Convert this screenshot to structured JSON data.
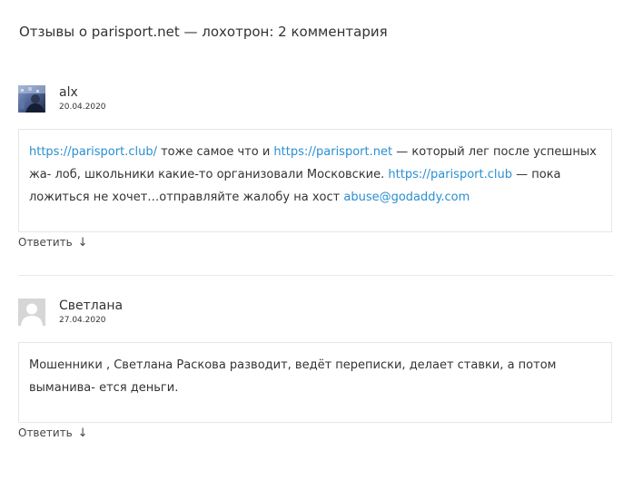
{
  "title": "Отзывы о parisport.net — лохотрон: 2 комментария",
  "comments": [
    {
      "author": "alx",
      "date": "20.04.2020",
      "avatar_icon": "user-photo-avatar",
      "body": {
        "link1": "https://parisport.club/",
        "text1": " тоже самое что и ",
        "link2": "https://parisport.net",
        "text2": " — который лег после успешных жа- лоб, школьники какие-то организовали Московские. ",
        "link3": "https://parisport.club",
        "text3": " — пока ложиться не хочет…отправляйте жалобу на хост ",
        "link4": "abuse@godaddy.com"
      },
      "reply_label": "Ответить",
      "reply_arrow": "↓"
    },
    {
      "author": "Светлана",
      "date": "27.04.2020",
      "avatar_icon": "default-user-avatar",
      "body": {
        "text": "Мошенники , Светлана Раскова разводит, ведёт переписки, делает ставки, а потом выманива- ется деньги."
      },
      "reply_label": "Ответить",
      "reply_arrow": "↓"
    }
  ],
  "colors": {
    "link": "#2a8fd1",
    "text": "#333333",
    "border": "#e6e6e6"
  }
}
